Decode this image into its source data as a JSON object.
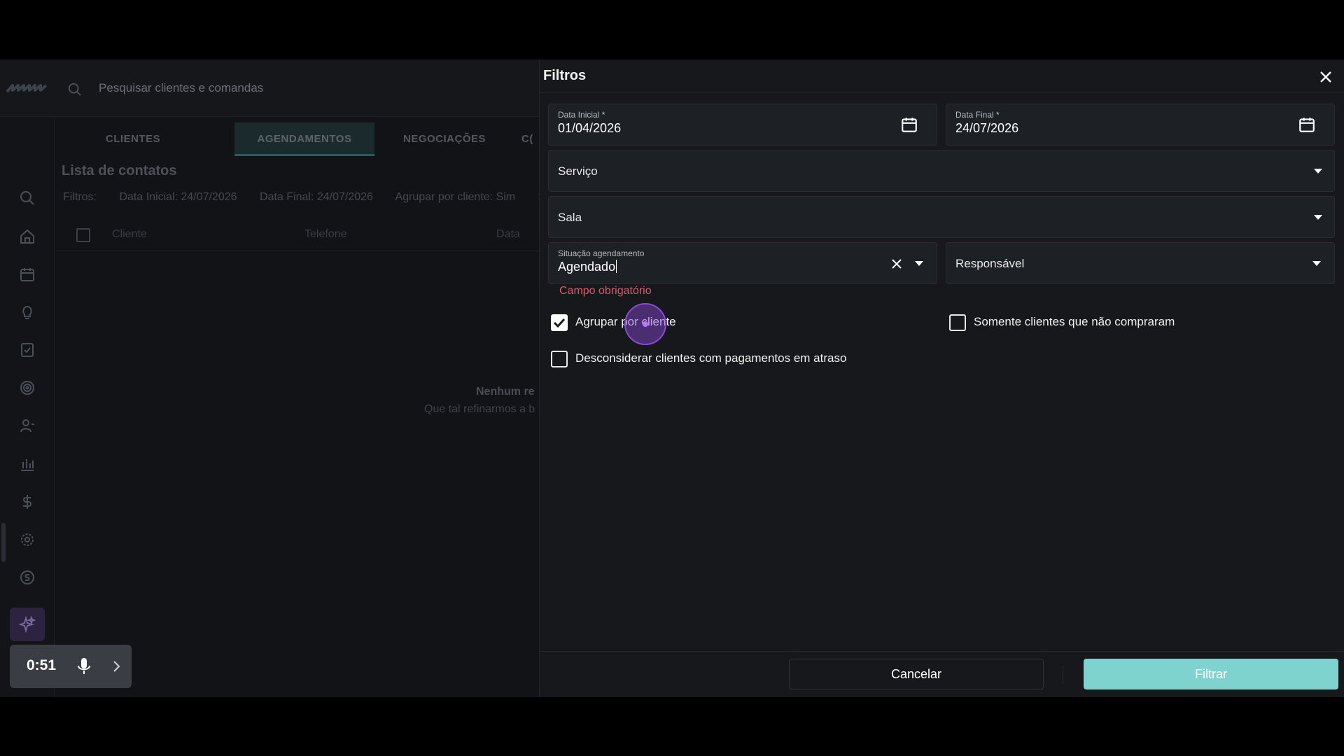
{
  "app": {
    "search_placeholder": "Pesquisar clientes e comandas",
    "tabs": [
      {
        "label": "CLIENTES"
      },
      {
        "label": "AGENDAMENTOS"
      },
      {
        "label": "NEGOCIAÇÕES"
      },
      {
        "label": "C("
      }
    ],
    "list_title": "Lista de contatos",
    "filters_prefix": "Filtros:",
    "filter_chips": [
      "Data Inicial: 24/07/2026",
      "Data Final: 24/07/2026",
      "Agrupar por cliente: Sim",
      ">"
    ],
    "columns": [
      "Cliente",
      "Telefone",
      "Data"
    ],
    "empty_title": "Nenhum re",
    "empty_subtitle": "Que tal refinarmos a b"
  },
  "recorder": {
    "time": "0:51"
  },
  "drawer": {
    "title": "Filtros",
    "start_date": {
      "label": "Data Inicial",
      "required_mark": "*",
      "value": "01/04/2026"
    },
    "end_date": {
      "label": "Data Final",
      "required_mark": "*",
      "value": "24/07/2026"
    },
    "service": {
      "placeholder": "Serviço"
    },
    "room": {
      "placeholder": "Sala"
    },
    "status": {
      "label": "Situação agendamento",
      "value": "Agendado",
      "error": "Campo obrigatório"
    },
    "responsible": {
      "placeholder": "Responsável"
    },
    "checks": {
      "group_by_client": {
        "label": "Agrupar por cliente",
        "checked": true
      },
      "only_non_buyers": {
        "label": "Somente clientes que não compraram",
        "checked": false
      },
      "ignore_late_payments": {
        "label": "Desconsiderar clientes com pagamentos em atraso",
        "checked": false
      }
    },
    "cancel_label": "Cancelar",
    "filter_label": "Filtrar",
    "accent_color": "#7fd3cf",
    "error_color": "#e0566b"
  }
}
